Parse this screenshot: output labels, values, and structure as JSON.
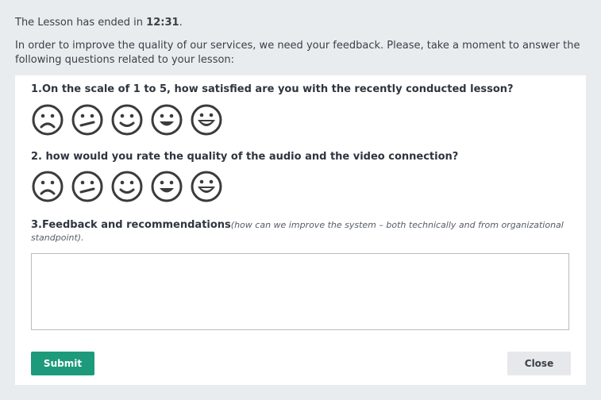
{
  "header": {
    "ended_prefix": "The Lesson has ended in ",
    "ended_time": "12:31",
    "ended_suffix": ".",
    "intro": "In order to improve the quality of our services, we need your feedback. Please, take a moment to answer the following questions related to your lesson:"
  },
  "questions": [
    {
      "text": "1.On the scale of 1 to 5, how satisfied are you with the recently conducted lesson?",
      "faces": [
        "very-sad-face-icon",
        "neutral-face-icon",
        "smile-face-icon",
        "happy-face-icon",
        "very-happy-face-icon"
      ]
    },
    {
      "text": "2. how would you rate the quality of the audio and the video connection?",
      "faces": [
        "very-sad-face-icon",
        "neutral-face-icon",
        "smile-face-icon",
        "happy-face-icon",
        "very-happy-face-icon"
      ]
    },
    {
      "text": "3.Feedback and recommendations",
      "hint": "(how can we improve the system – both technically and from organizational standpoint)."
    }
  ],
  "feedback_input": {
    "value": "",
    "placeholder": ""
  },
  "buttons": {
    "submit": "Submit",
    "close": "Close"
  },
  "colors": {
    "background": "#e9ecef",
    "panel": "#ffffff",
    "submit": "#1d9a7c",
    "close": "#e6e8eb",
    "icon_stroke": "#3b3b3b"
  }
}
